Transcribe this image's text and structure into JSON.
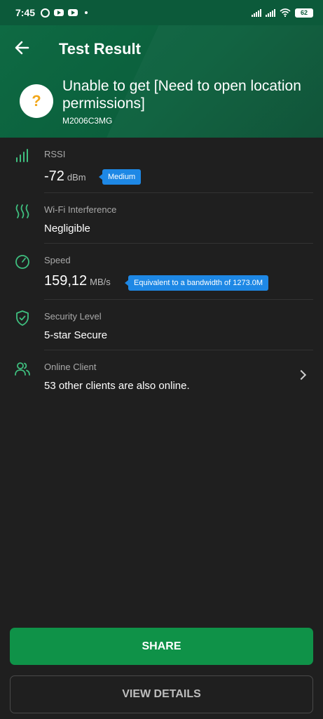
{
  "status_bar": {
    "time": "7:45",
    "battery": "62",
    "icons": [
      "whatsapp-icon",
      "youtube-icon",
      "youtube-icon",
      "dot-icon",
      "signal-icon",
      "signal-icon",
      "wifi-icon",
      "battery-icon"
    ]
  },
  "header": {
    "title": "Test Result",
    "result_text": "Unable to get [Need to open location permissions]",
    "device": "M2006C3MG",
    "result_icon_glyph": "?"
  },
  "rows": {
    "rssi": {
      "label": "RSSI",
      "value": "-72",
      "unit": "dBm",
      "badge": "Medium"
    },
    "interference": {
      "label": "Wi-Fi Interference",
      "value": "Negligible"
    },
    "speed": {
      "label": "Speed",
      "value": "159,12",
      "unit": "MB/s",
      "badge": "Equivalent to a bandwidth of 1273.0M"
    },
    "security": {
      "label": "Security Level",
      "value": "5-star Secure"
    },
    "clients": {
      "label": "Online Client",
      "value": "53 other clients are also online."
    }
  },
  "buttons": {
    "share": "SHARE",
    "details": "VIEW DETAILS"
  },
  "colors": {
    "header_green": "#0e6a43",
    "accent_green": "#0f9248",
    "badge_blue": "#1e88e5",
    "background": "#1f1f1f",
    "icon_green": "#3fbf7f"
  }
}
